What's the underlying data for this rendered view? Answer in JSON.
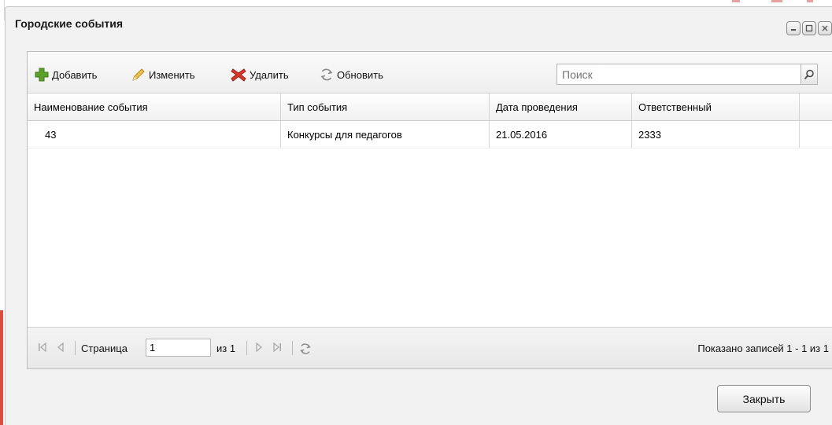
{
  "window": {
    "title": "Городские события",
    "controls": [
      "minimize",
      "maximize",
      "close"
    ]
  },
  "toolbar": {
    "add_label": "Добавить",
    "edit_label": "Изменить",
    "delete_label": "Удалить",
    "refresh_label": "Обновить",
    "search_placeholder": "Поиск"
  },
  "grid": {
    "columns": [
      "Наименование события",
      "Тип события",
      "Дата проведения",
      "Ответственный"
    ],
    "rows": [
      [
        "43",
        "Конкурсы для педагогов",
        "21.05.2016",
        "2333"
      ]
    ]
  },
  "pager": {
    "page_label": "Страница",
    "page_value": "1",
    "of_label": "из 1",
    "status": "Показано записей 1 - 1 из 1"
  },
  "footer": {
    "close_label": "Закрыть"
  },
  "colors": {
    "add_icon": "#5aa12a",
    "edit_icon": "#e6a521",
    "delete_icon": "#d8372a",
    "accent_left": "#e24a3a"
  }
}
